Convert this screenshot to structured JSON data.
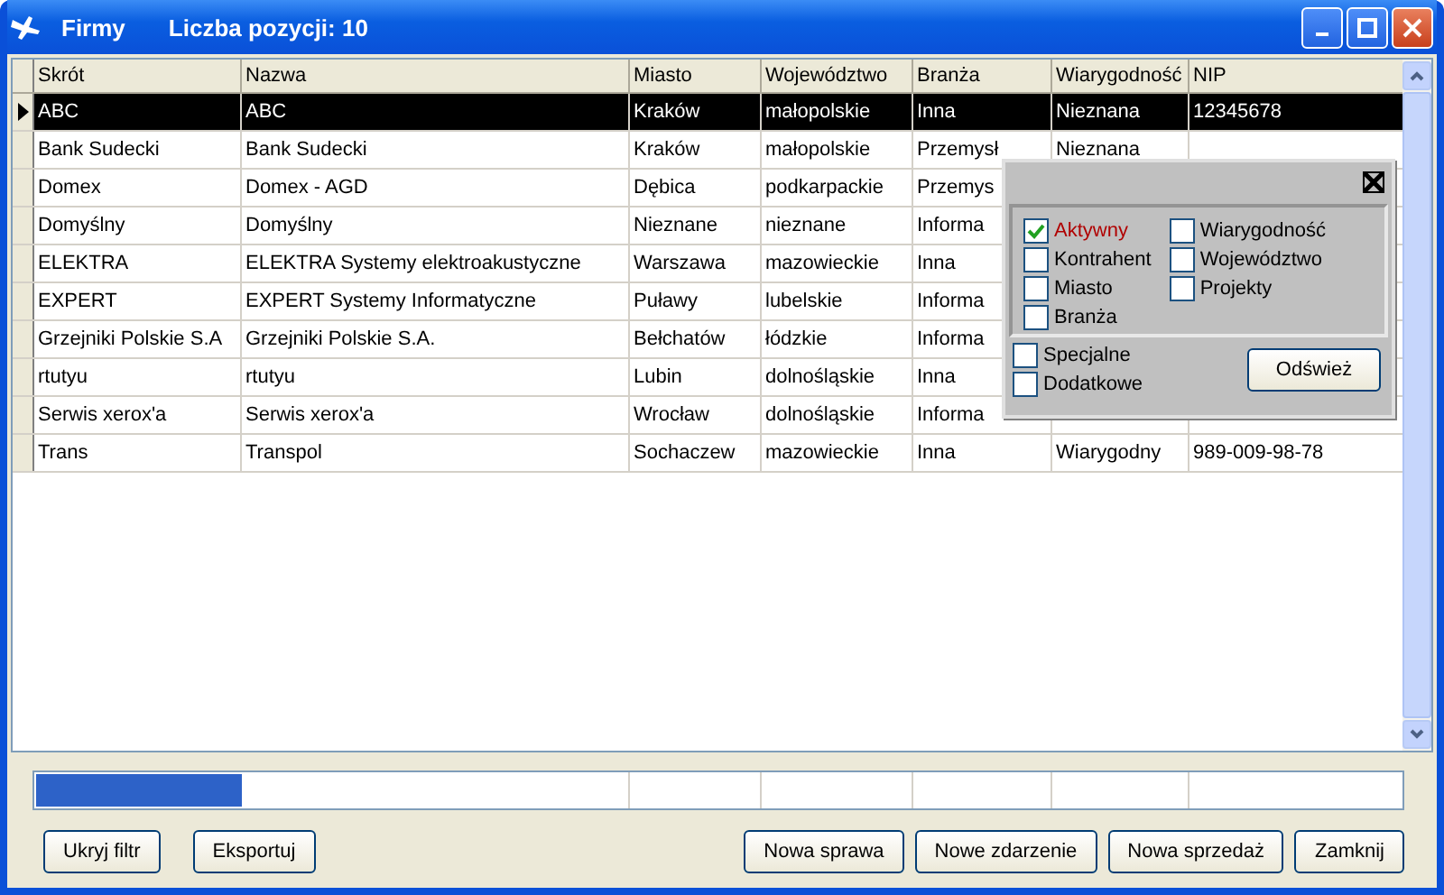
{
  "window": {
    "title": "Firmy",
    "subtitle": "Liczba pozycji: 10"
  },
  "table": {
    "columns": [
      "Skrót",
      "Nazwa",
      "Miasto",
      "Województwo",
      "Branża",
      "Wiarygodność",
      "NIP"
    ],
    "rows": [
      {
        "selected": true,
        "cells": [
          "ABC",
          "ABC",
          "Kraków",
          "małopolskie",
          "Inna",
          "Nieznana",
          "12345678"
        ]
      },
      {
        "selected": false,
        "cells": [
          "Bank Sudecki",
          "Bank Sudecki",
          "Kraków",
          "małopolskie",
          "Przemysł",
          "Nieznana"
        ]
      },
      {
        "selected": false,
        "cells": [
          "Domex",
          "Domex  - AGD",
          "Dębica",
          "podkarpackie",
          "Przemys"
        ]
      },
      {
        "selected": false,
        "cells": [
          "Domyślny",
          "Domyślny",
          "Nieznane",
          "nieznane",
          "Informa"
        ]
      },
      {
        "selected": false,
        "cells": [
          "ELEKTRA",
          "ELEKTRA Systemy elektroakustyczne",
          "Warszawa",
          "mazowieckie",
          "Inna"
        ]
      },
      {
        "selected": false,
        "cells": [
          "EXPERT",
          "EXPERT Systemy Informatyczne",
          "Puławy",
          "lubelskie",
          "Informa"
        ]
      },
      {
        "selected": false,
        "cells": [
          "Grzejniki Polskie S.A",
          "Grzejniki Polskie S.A.",
          "Bełchatów",
          "łódzkie",
          "Informa"
        ]
      },
      {
        "selected": false,
        "cells": [
          "rtutyu",
          "rtutyu",
          "Lubin",
          "dolnośląskie",
          "Inna"
        ]
      },
      {
        "selected": false,
        "cells": [
          "Serwis xerox'a",
          "Serwis xerox'a",
          "Wrocław",
          "dolnośląskie",
          "Informa"
        ]
      },
      {
        "selected": false,
        "cells": [
          "Trans",
          "Transpol",
          "Sochaczew",
          "mazowieckie",
          "Inna",
          "Wiarygodny",
          "989-009-98-78"
        ]
      }
    ]
  },
  "filter_panel": {
    "options_left": [
      {
        "label": "Aktywny",
        "checked": true,
        "focused": true
      },
      {
        "label": "Kontrahent",
        "checked": false,
        "focused": false
      },
      {
        "label": "Miasto",
        "checked": false,
        "focused": false
      },
      {
        "label": "Branża",
        "checked": false,
        "focused": false
      }
    ],
    "options_right": [
      {
        "label": "Wiarygodność",
        "checked": false,
        "focused": false
      },
      {
        "label": "Województwo",
        "checked": false,
        "focused": false
      },
      {
        "label": "Projekty",
        "checked": false,
        "focused": false
      }
    ],
    "extra_options": [
      {
        "label": "Specjalne",
        "checked": false,
        "focused": false
      },
      {
        "label": "Dodatkowe",
        "checked": false,
        "focused": false
      }
    ],
    "refresh_button": "Odśwież"
  },
  "summary_bar": {
    "level": 0.15
  },
  "buttons_left": [
    "Ukryj filtr",
    "Eksportuj"
  ],
  "buttons_right": [
    "Nowa sprawa",
    "Nowe zdarzenie",
    "Nowa sprzedaż",
    "Zamknij"
  ]
}
